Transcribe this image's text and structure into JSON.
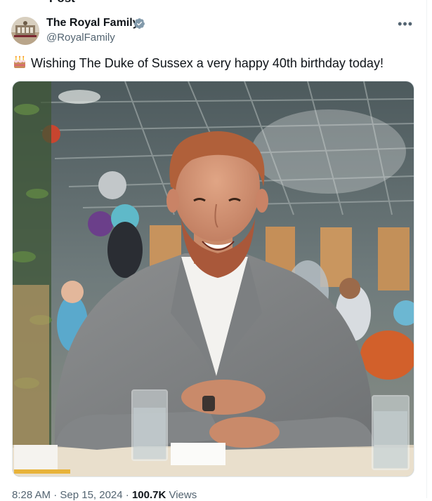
{
  "tweet": {
    "author_name": "The Royal Family",
    "author_handle": "@RoyalFamily",
    "more_label": "•••",
    "text": "Wishing The Duke of Sussex a very happy 40th birthday today!",
    "emoji_icon": "birthday-cake-icon",
    "timestamp": "8:28 AM · Sep 15, 2024 · ",
    "views_count": "100.7K",
    "views_label": " Views",
    "top_cut_text": "Post"
  },
  "colors": {
    "verified": "#829aab",
    "text": "#0f1419",
    "muted": "#536471"
  }
}
